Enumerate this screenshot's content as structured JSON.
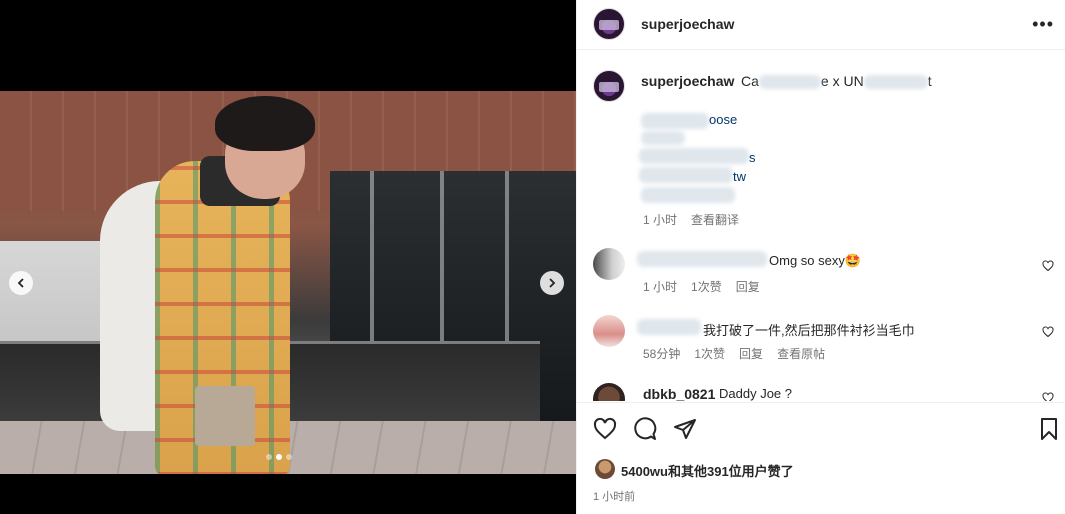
{
  "post": {
    "username": "superjoechaw",
    "more_label": "•••"
  },
  "media": {
    "carousel_dots": 3,
    "active_dot": 1
  },
  "caption": {
    "username": "superjoechaw",
    "text_visible_1": "Ca",
    "text_visible_2": "e x UN",
    "text_visible_3": "t",
    "link_1_tail": "oose",
    "link_2_tail": "s",
    "link_3_tail": "tw",
    "time": "1 小时",
    "translate_label": "查看翻译"
  },
  "comments": [
    {
      "username_hidden": true,
      "text": "Omg so sexy🤩",
      "time": "1 小时",
      "likes": "1次赞",
      "reply": "回复"
    },
    {
      "username_hidden": true,
      "text": "我打破了一件,然后把那件衬衫当毛巾",
      "time": "58分钟",
      "likes": "1次赞",
      "reply": "回复",
      "view_original": "查看原帖"
    },
    {
      "username": "dbkb_0821",
      "text": "Daddy Joe ?"
    }
  ],
  "likes": {
    "text": "5400wu和其他391位用户赞了",
    "user": "5400wu",
    "rest": "和其他391位用户赞了"
  },
  "posted_ago": "1 小时前",
  "colors": {
    "text": "#262626",
    "secondary": "#737373",
    "link": "#00376b",
    "divider": "#efefef"
  }
}
